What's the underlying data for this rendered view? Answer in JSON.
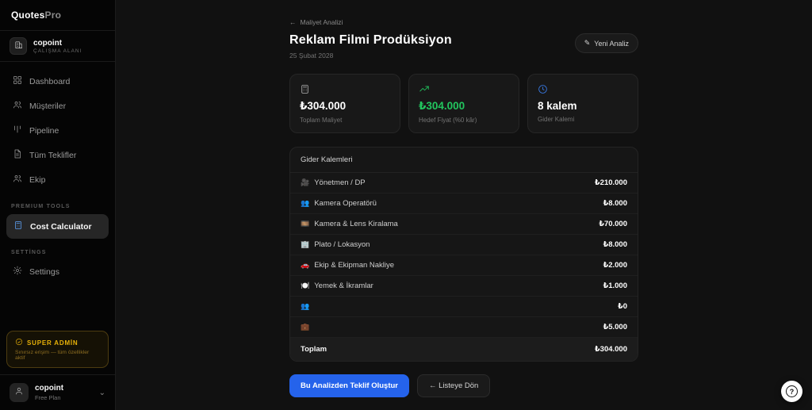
{
  "app": {
    "brand_primary": "Quotes",
    "brand_secondary": "Pro"
  },
  "colors": {
    "accent_blue": "#2563eb",
    "success_green": "#22c55e",
    "info_blue": "#3b82f6",
    "admin_gold": "#eab308"
  },
  "sidebar": {
    "workspace": {
      "name": "copoint",
      "label": "ÇALIŞMA ALANI"
    },
    "nav": [
      {
        "label": "Dashboard"
      },
      {
        "label": "Müşteriler"
      },
      {
        "label": "Pipeline"
      },
      {
        "label": "Tüm Teklifler"
      },
      {
        "label": "Ekip"
      }
    ],
    "premium_section_label": "PREMIUM TOOLS",
    "premium_item": {
      "label": "Cost Calculator"
    },
    "settings_section_label": "SETTİNGS",
    "settings_item": {
      "label": "Settings"
    },
    "admin_badge": {
      "title": "SUPER ADMİN",
      "subtitle": "Sınırsız erişim — tüm özellikler aktif"
    },
    "user": {
      "name": "copoint",
      "plan": "Free Plan",
      "chevron": "⌄"
    }
  },
  "header": {
    "back_arrow": "←",
    "breadcrumb": "Maliyet Analizi",
    "title": "Reklam Filmi Prodüksiyon",
    "date": "25 Şubat 2028",
    "new_analysis_icon": "✎",
    "new_analysis_label": "Yeni Analiz"
  },
  "stats": [
    {
      "icon_name": "calculator-icon",
      "value": "₺304.000",
      "label": "Toplam Maliyet"
    },
    {
      "icon_name": "trending-up-icon",
      "value": "₺304.000",
      "label": "Hedef Fiyat (%0 kâr)"
    },
    {
      "icon_name": "clock-icon",
      "value": "8 kalem",
      "label": "Gider Kalemi"
    }
  ],
  "table": {
    "title": "Gider Kalemleri",
    "rows": [
      {
        "emoji": "🎥",
        "label": "Yönetmen / DP",
        "amount": "₺210.000"
      },
      {
        "emoji": "👥",
        "label": "Kamera Operatörü",
        "amount": "₺8.000"
      },
      {
        "emoji": "🎞️",
        "label": "Kamera & Lens Kiralama",
        "amount": "₺70.000"
      },
      {
        "emoji": "🏢",
        "label": "Plato / Lokasyon",
        "amount": "₺8.000"
      },
      {
        "emoji": "🚗",
        "label": "Ekip & Ekipman Nakliye",
        "amount": "₺2.000"
      },
      {
        "emoji": "🍽️",
        "label": "Yemek & İkramlar",
        "amount": "₺1.000"
      },
      {
        "emoji": "👥",
        "label": "",
        "amount": "₺0"
      },
      {
        "emoji": "💼",
        "label": "",
        "amount": "₺5.000"
      }
    ],
    "footer": {
      "label": "Toplam",
      "amount": "₺304.000"
    }
  },
  "actions": {
    "primary_label": "Bu Analizden Teklif Oluştur",
    "secondary_label": "← Listeye Dön"
  },
  "help": {
    "glyph": "?"
  }
}
